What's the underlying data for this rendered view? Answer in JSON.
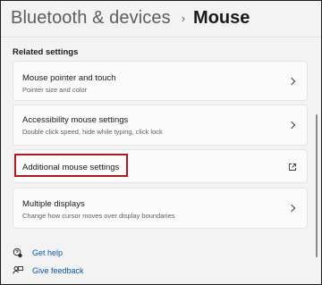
{
  "header": {
    "parent": "Bluetooth & devices",
    "separator": "›",
    "current": "Mouse"
  },
  "section_title": "Related settings",
  "cards": [
    {
      "title": "Mouse pointer and touch",
      "subtitle": "Pointer size and color",
      "action": "chevron-right-icon"
    },
    {
      "title": "Accessibility mouse settings",
      "subtitle": "Double click speed, hide while typing, click lock",
      "action": "chevron-right-icon"
    },
    {
      "title": "Additional mouse settings",
      "subtitle": "",
      "action": "external-link-icon"
    },
    {
      "title": "Multiple displays",
      "subtitle": "Change how cursor moves over display boundaries",
      "action": "chevron-right-icon"
    }
  ],
  "footer": {
    "help_label": "Get help",
    "feedback_label": "Give feedback"
  },
  "colors": {
    "background": "#f3f3f3",
    "card": "#fbfbfb",
    "link": "#0a56a4",
    "highlight": "#b3181e"
  }
}
